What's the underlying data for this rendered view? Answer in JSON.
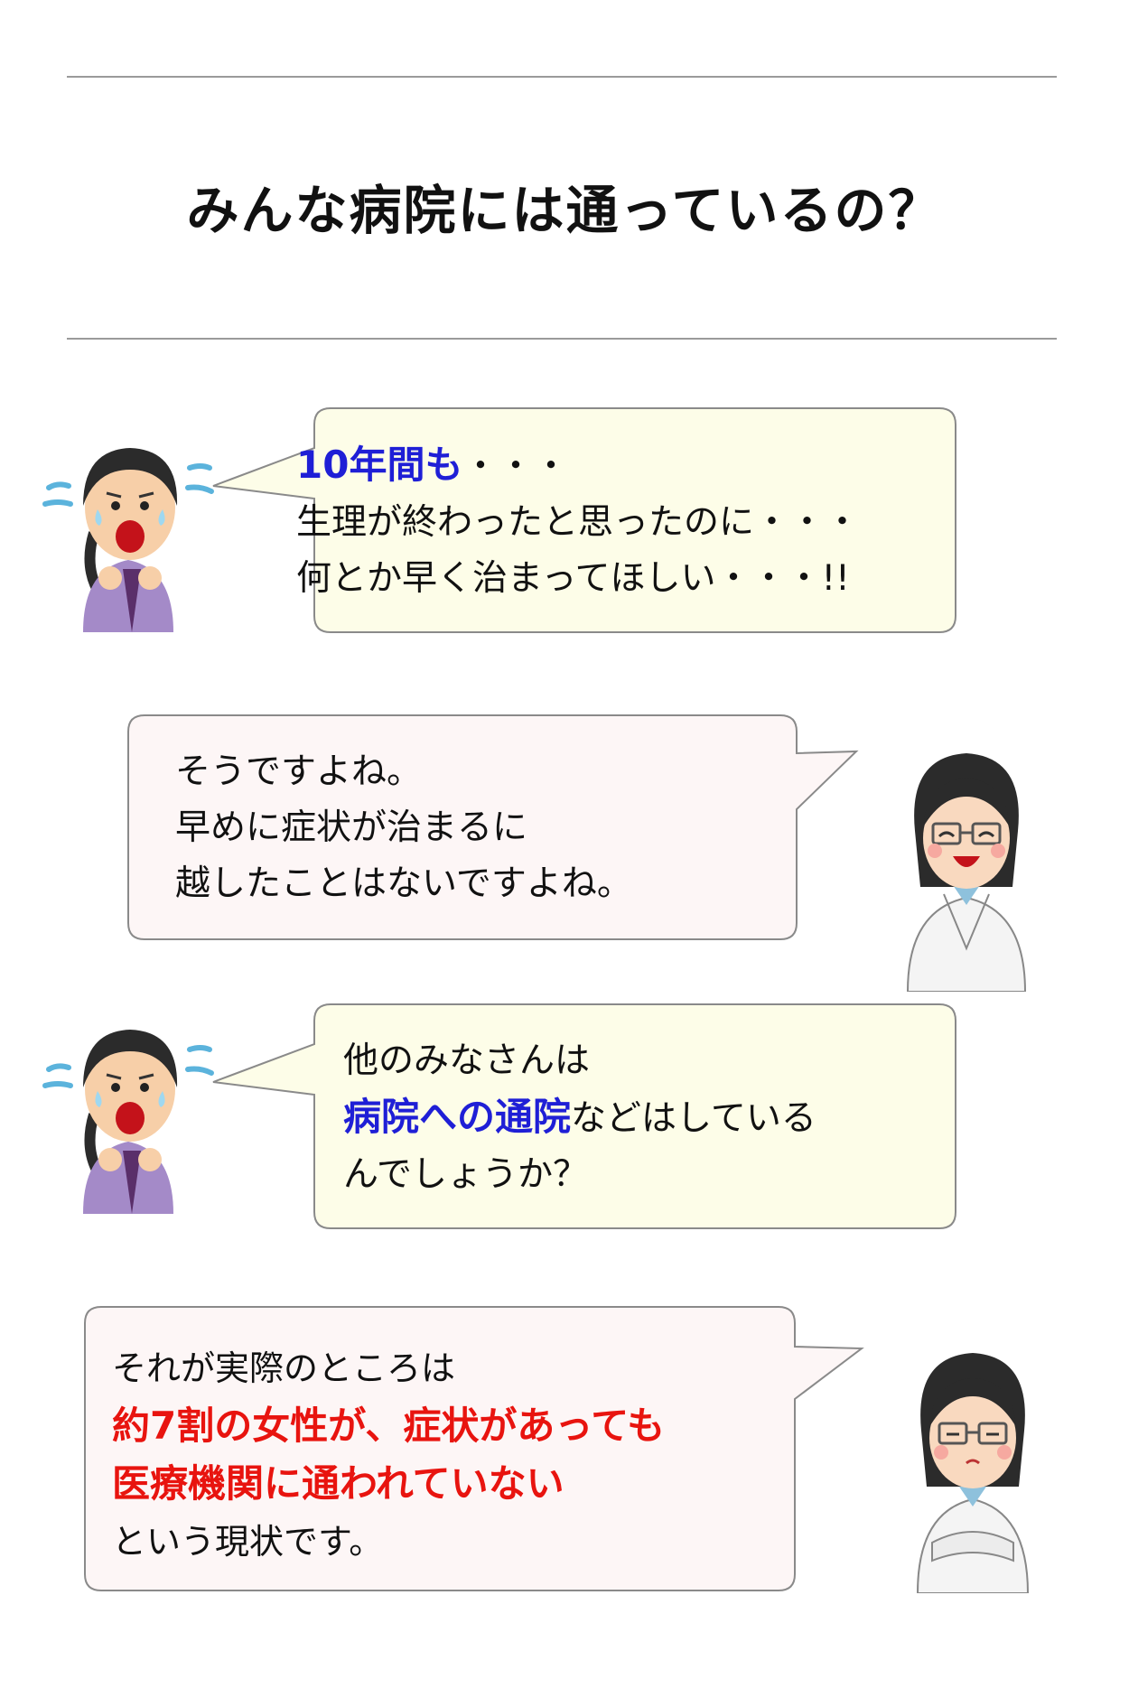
{
  "page_title": "みんな病院には通っているの？",
  "colors": {
    "patient_bubble": "#fdfde8",
    "doctor_bubble": "#fdf6f6",
    "bubble_border": "#8a8a8a",
    "highlight_blue": "#1f1fd6",
    "highlight_red": "#e8140f"
  },
  "dialogue": [
    {
      "speaker_icon": "worried-woman-icon",
      "line1_highlight": "10年間も",
      "line1_rest": "・・・",
      "line2": "生理が終わったと思ったのに・・・",
      "line3": "何とか早く治まってほしい・・・!!"
    },
    {
      "speaker_icon": "smiling-doctor-icon",
      "line1": "そうですよね。",
      "line2": "早めに症状が治まるに",
      "line3": "越したことはないですよね。"
    },
    {
      "speaker_icon": "worried-woman-icon",
      "line1": "他のみなさんは",
      "line2_highlight": "病院への通院",
      "line2_rest": "などはしている",
      "line3": "んでしょうか？"
    },
    {
      "speaker_icon": "serious-doctor-icon",
      "line1": "それが実際のところは",
      "line2_highlight": "約7割の女性が、症状があっても",
      "line3_highlight": "医療機関に通われていない",
      "line4": "という現状です。"
    }
  ]
}
